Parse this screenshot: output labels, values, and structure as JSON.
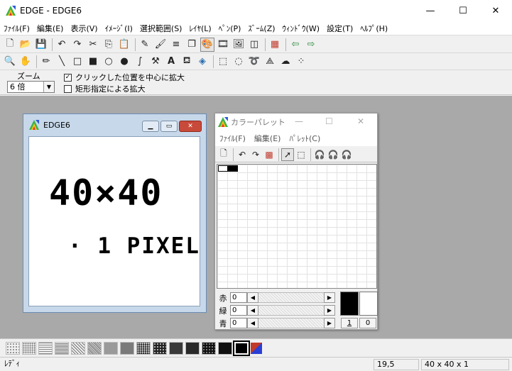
{
  "window": {
    "title": "EDGE - EDGE6",
    "minimize": "—",
    "maximize": "☐",
    "close": "✕"
  },
  "menu": [
    "ﾌｧｲﾙ(F)",
    "編集(E)",
    "表示(V)",
    "ｲﾒｰｼﾞ(I)",
    "選択範囲(S)",
    "ﾚｲﾔ(L)",
    "ﾍﾟﾝ(P)",
    "ｽﾞｰﾑ(Z)",
    "ｳｨﾝﾄﾞｳ(W)",
    "設定(T)",
    "ﾍﾙﾌﾟ(H)"
  ],
  "toolbar1": [
    "new-file-icon",
    "open-folder-icon",
    "save-icon",
    "sep",
    "undo-icon",
    "redo-icon",
    "cut-icon",
    "copy-icon",
    "paste-icon",
    "sep",
    "pen-settings-icon",
    "brush-settings-icon",
    "line-width-icon",
    "layer-icon",
    "palette-icon",
    "film-icon",
    "image-icon",
    "frame-icon",
    "sep",
    "grid-icon",
    "sep",
    "arrow-left-icon",
    "arrow-right-icon"
  ],
  "toolbar2": [
    "zoom-icon",
    "hand-icon",
    "sep",
    "pencil-icon",
    "line-icon",
    "rectangle-icon",
    "filled-rectangle-icon",
    "ellipse-icon",
    "filled-ellipse-icon",
    "curve-icon",
    "hammer-icon",
    "text-icon",
    "spray-icon",
    "fill-icon",
    "sep",
    "select-rect-icon",
    "select-ellipse-icon",
    "lasso-icon",
    "polygon-select-icon",
    "blob-icon",
    "magic-select-icon"
  ],
  "zoom": {
    "label": "ズーム",
    "value": "6 倍",
    "center_click_label": "クリックした位置を中心に拡大",
    "center_click_checked": true,
    "rect_zoom_label": "矩形指定による拡大",
    "rect_zoom_checked": false
  },
  "child_window": {
    "title": "EDGE6",
    "canvas_text_big": "40×40",
    "canvas_text_small": "· 1 PIXEL"
  },
  "palette_window": {
    "title": "カラーパレット",
    "menu": [
      "ﾌｧｲﾙ(F)",
      "編集(E)",
      "ﾊﾟﾚｯﾄ(C)"
    ],
    "tools": [
      "new-palette-icon",
      "sep",
      "undo-icon",
      "redo-icon",
      "color-picker-icon",
      "sep",
      "arrow-select-icon",
      "rect-select-icon",
      "sep",
      "headphones-icon-1",
      "headphones-icon-2",
      "headphones-icon-3"
    ],
    "swatches": [
      "#ffffff",
      "#000000"
    ],
    "rows": [
      {
        "label": "赤",
        "value": "0"
      },
      {
        "label": "緑",
        "value": "0"
      },
      {
        "label": "青",
        "value": "0"
      }
    ],
    "foreground_color": "#000000",
    "background_color": "#ffffff",
    "fg_index": "1",
    "bg_index": "0"
  },
  "patterns": 16,
  "status": {
    "mode": "ﾚﾃﾞｨ",
    "coords": "19,5",
    "size": "40 x 40 x 1"
  },
  "colors": {
    "accent": "#c7d8ea",
    "workspace": "#a9a9a9",
    "close_red": "#c84a3a"
  }
}
